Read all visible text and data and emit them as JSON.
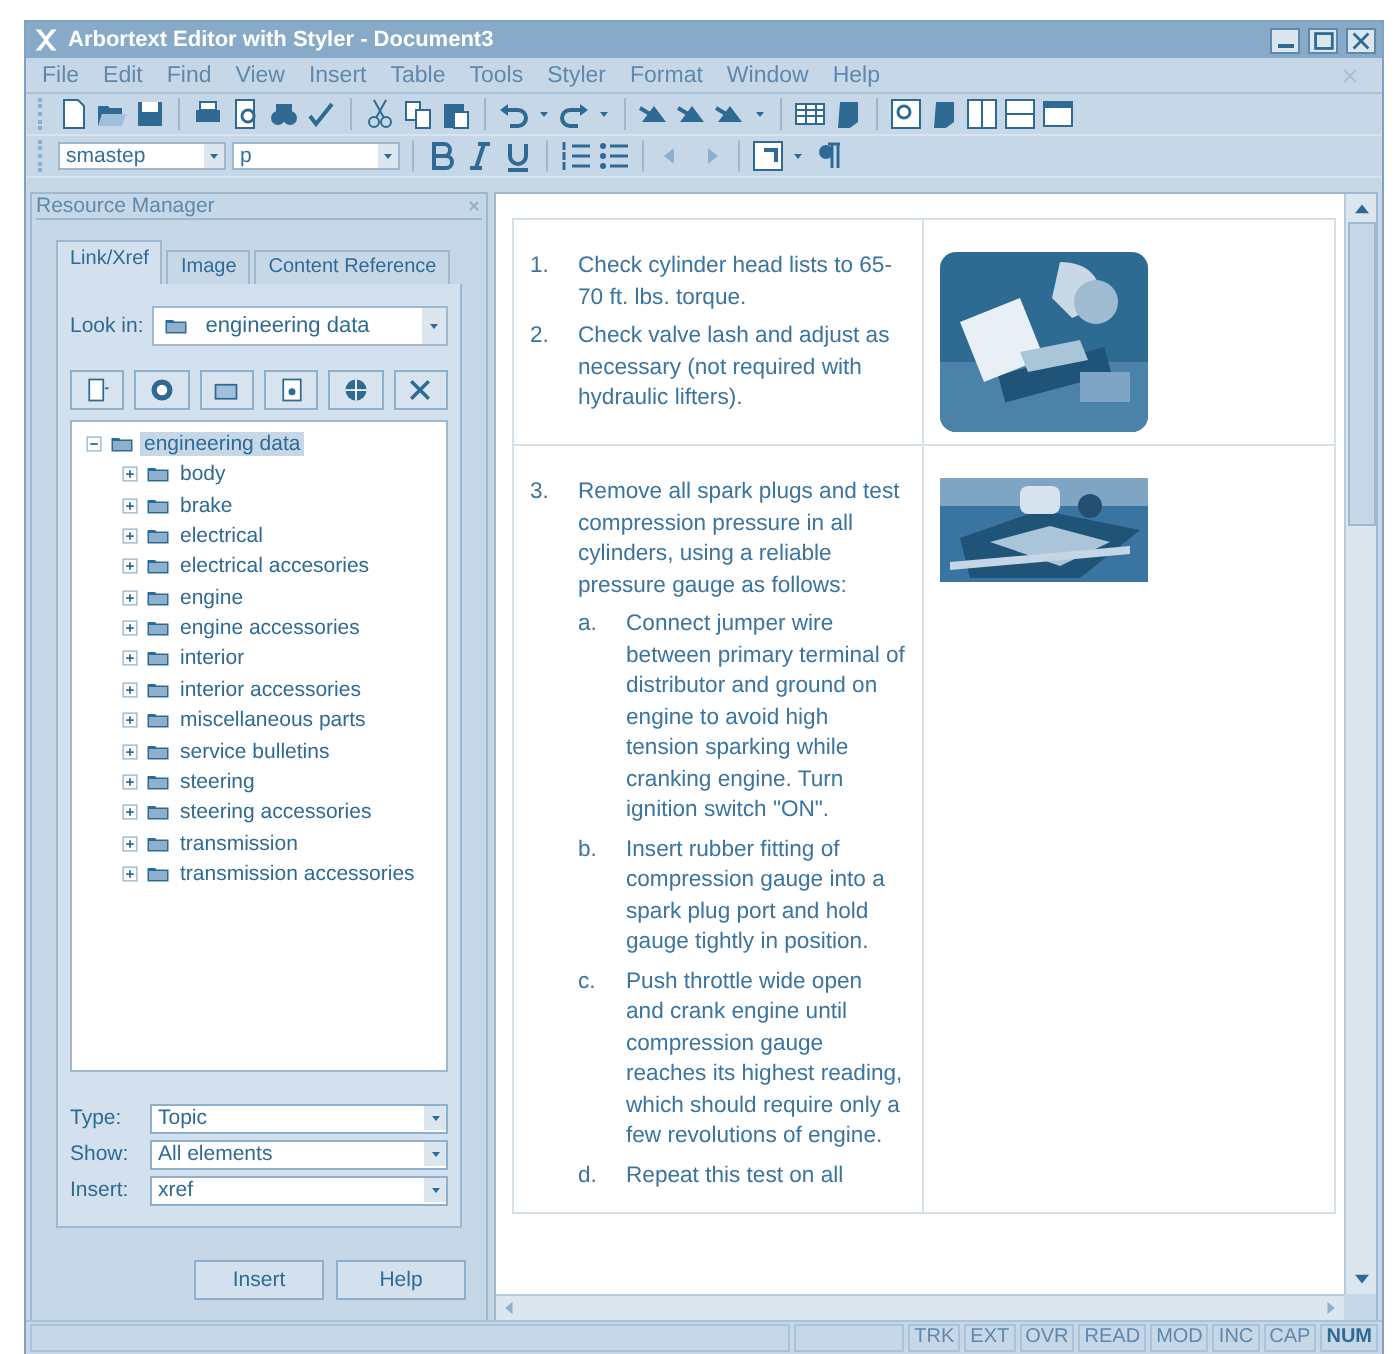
{
  "window": {
    "title": "Arbortext Editor with Styler - Document3"
  },
  "menu": [
    "File",
    "Edit",
    "Find",
    "View",
    "Insert",
    "Table",
    "Tools",
    "Styler",
    "Format",
    "Window",
    "Help"
  ],
  "format_bar": {
    "style_combo": "smastep",
    "element_combo": "p"
  },
  "resource_manager": {
    "title": "Resource Manager",
    "tabs": [
      {
        "label": "Link/Xref",
        "selected": true
      },
      {
        "label": "Image",
        "selected": false
      },
      {
        "label": "Content Reference",
        "selected": false
      }
    ],
    "look_in": {
      "label": "Look in:",
      "value": "engineering data"
    },
    "tree": [
      {
        "label": "engineering data",
        "expanded": true,
        "selected": true,
        "children": [
          {
            "label": "body",
            "expanded": false,
            "selected": false
          },
          {
            "label": "brake",
            "expanded": false,
            "selected": false
          },
          {
            "label": "electrical",
            "expanded": false,
            "selected": false
          },
          {
            "label": "electrical accesories",
            "expanded": false,
            "selected": false
          },
          {
            "label": "engine",
            "expanded": false,
            "selected": false
          },
          {
            "label": "engine accessories",
            "expanded": false,
            "selected": false
          },
          {
            "label": "interior",
            "expanded": false,
            "selected": false
          },
          {
            "label": "interior accessories",
            "expanded": false,
            "selected": false
          },
          {
            "label": "miscellaneous parts",
            "expanded": false,
            "selected": false
          },
          {
            "label": "service bulletins",
            "expanded": false,
            "selected": false
          },
          {
            "label": "steering",
            "expanded": false,
            "selected": false
          },
          {
            "label": "steering accessories",
            "expanded": false,
            "selected": false
          },
          {
            "label": "transmission",
            "expanded": false,
            "selected": false
          },
          {
            "label": "transmission accessories",
            "expanded": false,
            "selected": false
          }
        ]
      }
    ],
    "fields": [
      {
        "label": "Type:",
        "value": "Topic"
      },
      {
        "label": "Show:",
        "value": "All elements"
      },
      {
        "label": "Insert:",
        "value": "xref"
      }
    ],
    "buttons": [
      "Insert",
      "Help"
    ]
  },
  "document": {
    "rows": [
      {
        "steps": [
          {
            "number": "1.",
            "text": "Check cylinder head lists to 65-70 ft. lbs. torque."
          },
          {
            "number": "2.",
            "text": "Check valve lash and adjust as necessary (not required with hydraulic lifters)."
          }
        ],
        "image": {
          "kind": "picture"
        }
      },
      {
        "steps": [
          {
            "number": "3.",
            "text": "Remove all spark plugs and test compression pressure in all cylinders, using a reliable pressure gauge as follows:",
            "substeps": [
              {
                "letter": "a.",
                "text": "Connect jumper wire between primary terminal of distributor and ground on engine to avoid high tension sparking while cranking engine. Turn ignition switch \"ON\"."
              },
              {
                "letter": "b.",
                "text": "Insert rubber fitting of compression gauge into a spark plug port and hold gauge tightly in position."
              },
              {
                "letter": "c.",
                "text": "Push throttle wide open and crank engine until compression gauge reaches its highest reading, which should require only a few revolutions of engine."
              },
              {
                "letter": "d.",
                "text": "Repeat this test on all"
              }
            ]
          }
        ],
        "image": {
          "kind": "picture"
        }
      }
    ]
  },
  "status_bar": {
    "indicators": [
      {
        "label": "TRK",
        "on": false
      },
      {
        "label": "EXT",
        "on": false
      },
      {
        "label": "OVR",
        "on": false
      },
      {
        "label": "READ",
        "on": false
      },
      {
        "label": "MOD",
        "on": false
      },
      {
        "label": "INC",
        "on": false
      },
      {
        "label": "CAP",
        "on": false
      },
      {
        "label": "NUM",
        "on": true
      }
    ]
  }
}
